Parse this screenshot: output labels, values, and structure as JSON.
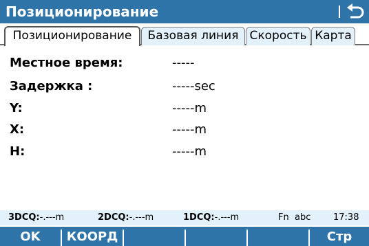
{
  "window": {
    "title": "Позиционирование",
    "back_icon": "return-arrow-icon"
  },
  "tabs": [
    {
      "label": "Позиционирование",
      "active": true
    },
    {
      "label": "Базовая линия",
      "active": false
    },
    {
      "label": "Скорость",
      "active": false
    },
    {
      "label": "Карта",
      "active": false
    }
  ],
  "fields": [
    {
      "label": "Местное время:",
      "value": "-----"
    },
    {
      "label": "Задержка :",
      "value": "-----sec"
    },
    {
      "label": "Y:",
      "value": "-----m"
    },
    {
      "label": "X:",
      "value": "-----m"
    },
    {
      "label": "H:",
      "value": "-----m"
    }
  ],
  "status": {
    "dcq3_label": "3DCQ:",
    "dcq3_value": "-.---m",
    "dcq2_label": "2DCQ:",
    "dcq2_value": "-.---m",
    "dcq1_label": "1DCQ:",
    "dcq1_value": "-.---m",
    "input_mode": "Fn  abc",
    "time": "17:38"
  },
  "function_keys": [
    {
      "label": "OK"
    },
    {
      "label": "КООРД"
    },
    {
      "label": ""
    },
    {
      "label": ""
    },
    {
      "label": ""
    },
    {
      "label": "Стр"
    }
  ],
  "colors": {
    "title_bar": "#2f74a8",
    "status_bar": "#e3f1fb",
    "inactive_tab": "#e3f1fb"
  }
}
